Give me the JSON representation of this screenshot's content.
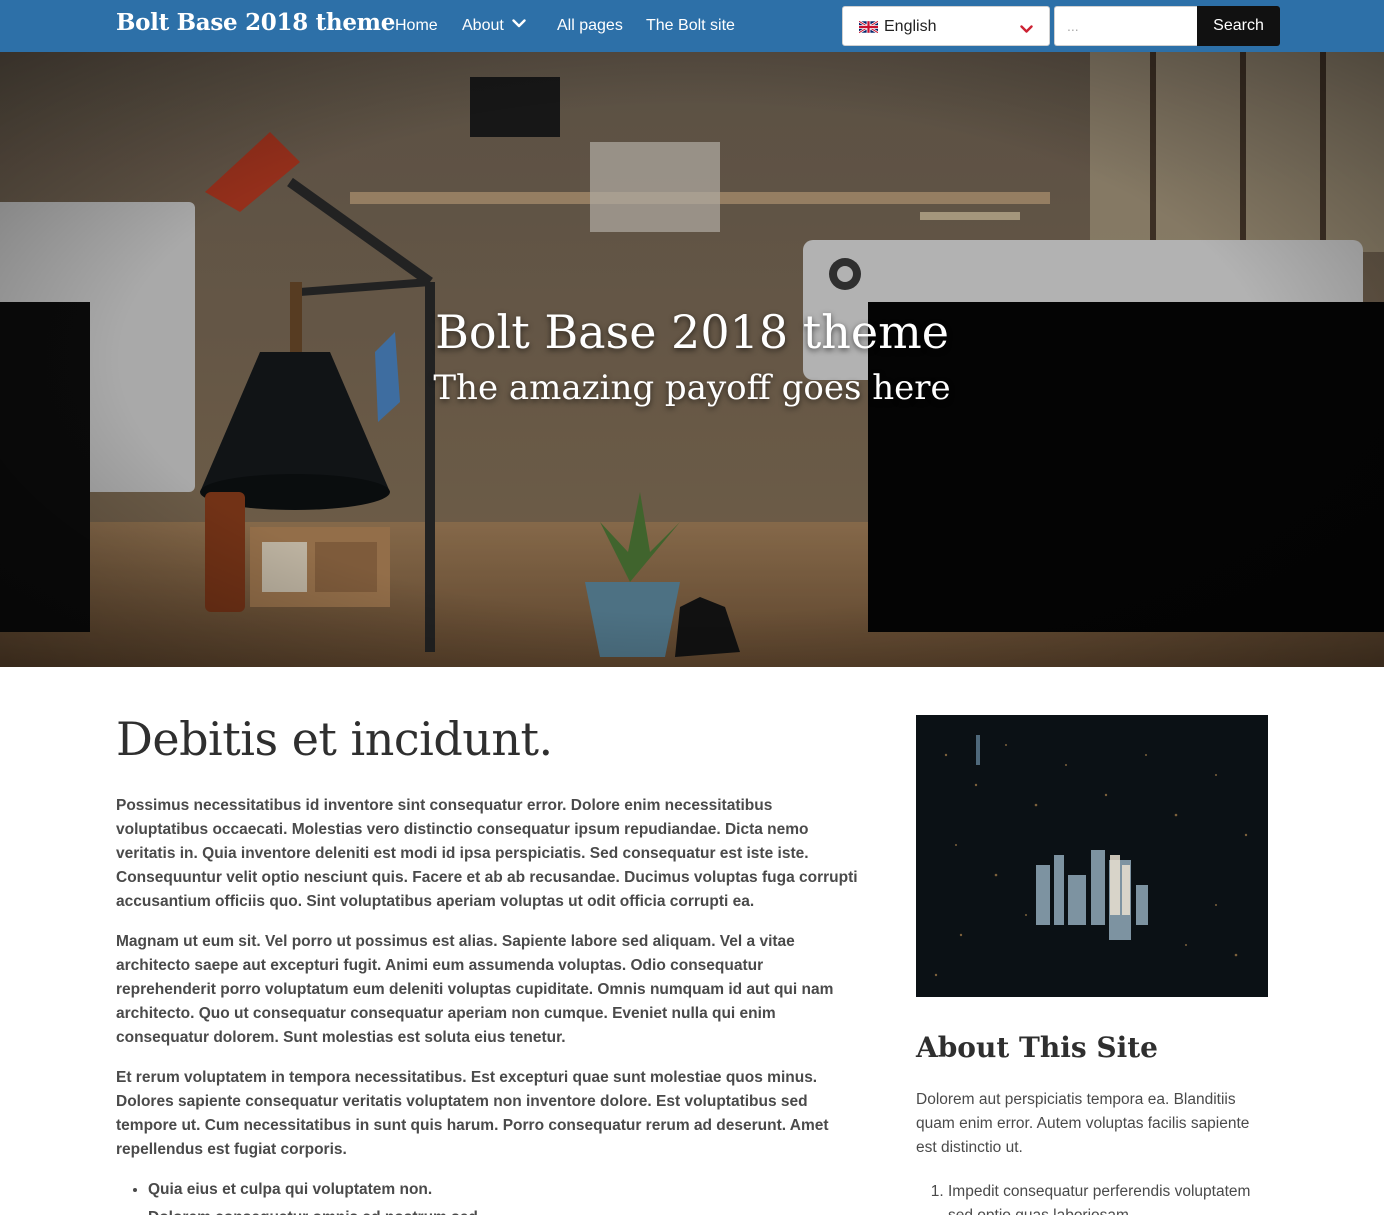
{
  "header": {
    "brand": "Bolt Base 2018 theme",
    "nav": {
      "home": "Home",
      "about": "About",
      "all_pages": "All pages",
      "bolt_site": "The Bolt site"
    },
    "language": {
      "selected": "English",
      "flag_icon": "uk-flag-icon"
    },
    "search": {
      "placeholder": "...",
      "value": "",
      "button_label": "Search"
    }
  },
  "hero": {
    "title": "Bolt Base 2018 theme",
    "subtitle": "The amazing payoff goes here"
  },
  "article": {
    "title": "Debitis et incidunt.",
    "paragraphs": [
      "Possimus necessitatibus id inventore sint consequatur error. Dolore enim necessitatibus voluptatibus occaecati. Molestias vero distinctio consequatur ipsum repudiandae. Dicta nemo veritatis in. Quia inventore deleniti est modi id ipsa perspiciatis. Sed consequatur est iste iste. Consequuntur velit optio nesciunt quis. Facere et ab ab recusandae. Ducimus voluptas fuga corrupti accusantium officiis quo. Sint voluptatibus aperiam voluptas ut odit officia corrupti ea.",
      "Magnam ut eum sit. Vel porro ut possimus est alias. Sapiente labore sed aliquam. Vel a vitae architecto saepe aut excepturi fugit. Animi eum assumenda voluptas. Odio consequatur reprehenderit porro voluptatum eum deleniti voluptas cupiditate. Omnis numquam id aut qui nam architecto. Quo ut consequatur consequatur aperiam non cumque. Eveniet nulla qui enim consequatur dolorem. Sunt molestias est soluta eius tenetur.",
      "Et rerum voluptatem in tempora necessitatibus. Est excepturi quae sunt molestiae quos minus. Dolores sapiente consequatur veritatis voluptatem non inventore dolore. Est voluptatibus sed tempore ut. Cum necessitatibus in sunt quis harum. Porro consequatur rerum ad deserunt. Amet repellendus est fugiat corporis."
    ],
    "list": [
      "Quia eius et culpa qui voluptatem non.",
      "Dolorem consequatur omnis ad nostrum sed."
    ]
  },
  "sidebar": {
    "title": "About This Site",
    "text": "Dolorem aut perspiciatis tempora ea. Blanditiis quam enim error. Autem voluptas facilis sapiente est distinctio ut.",
    "list": [
      "Impedit consequatur perferendis voluptatem sed optio quas laboriosam."
    ]
  },
  "colors": {
    "navbar": "#2d70a8",
    "search_button": "#111111",
    "chevron_accent": "#cc2233"
  }
}
